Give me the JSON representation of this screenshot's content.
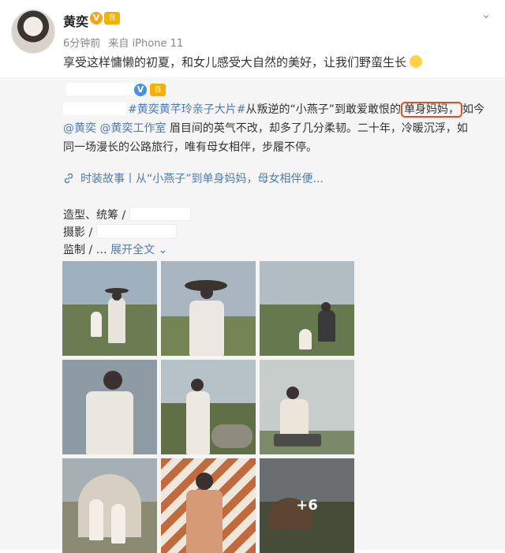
{
  "post": {
    "author": "黄奕",
    "verified_badge": "V",
    "level_badge": "自",
    "time": "6分钟前",
    "source": "来自 iPhone 11",
    "text": "享受这样慵懒的初夏，和女儿感受大自然的美好，让我们野蛮生长"
  },
  "repost": {
    "verified_badge": "V",
    "level_badge": "自",
    "line1_hashtag": "#黄奕黄芊玲亲子大片#",
    "line1_text": "从叛逆的“小燕子”到敢爱敢恨的",
    "line1_highlight": "单身妈妈，",
    "line1_tail": "如今",
    "line2_mention1": "@黄奕",
    "line2_mention2": "@黄奕工作室",
    "line2_text": "眉目间的英气不改，却多了几分柔韧。二十年，冷暖沉浮，如",
    "line3_text": "同一场漫长的公路旅行，唯有母女相伴，步履不停。",
    "link_text": "时装故事丨从“小燕子”到单身妈妈，母女相伴便...",
    "credit_styling": "造型、统筹 /",
    "credit_photo": "摄影 /",
    "credit_production": "监制 / …",
    "expand_text": "展开全文",
    "more_count": "+6"
  },
  "colors": {
    "link_blue": "#4f7ab5",
    "highlight_border": "#e44d26",
    "badge_gold": "#f7a31c",
    "repost_bg": "#f5f5f5"
  },
  "icons": [
    "chevron-down-icon",
    "link-icon",
    "expand-arrow-icon"
  ]
}
